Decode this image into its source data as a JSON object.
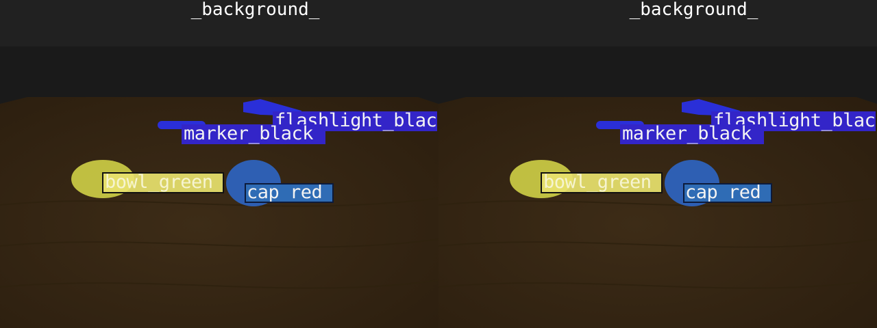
{
  "colors": {
    "header_bg": "#212121",
    "wall": "#181818",
    "table": "#3a2a16",
    "flashlight_label": "#3325c8",
    "marker_label": "#3325c8",
    "bowl_label": "#e8e26e",
    "cap_label": "#2f6cb5"
  },
  "panels": [
    {
      "title": "_background_",
      "labels": {
        "flashlight": "flashlight_black",
        "marker": "marker_black",
        "bowl": "bowl_green",
        "cap": "cap_red"
      }
    },
    {
      "title": "_background_",
      "labels": {
        "flashlight": "flashlight_black",
        "marker": "marker_black",
        "bowl": "bowl_green",
        "cap": "cap_red"
      }
    }
  ]
}
